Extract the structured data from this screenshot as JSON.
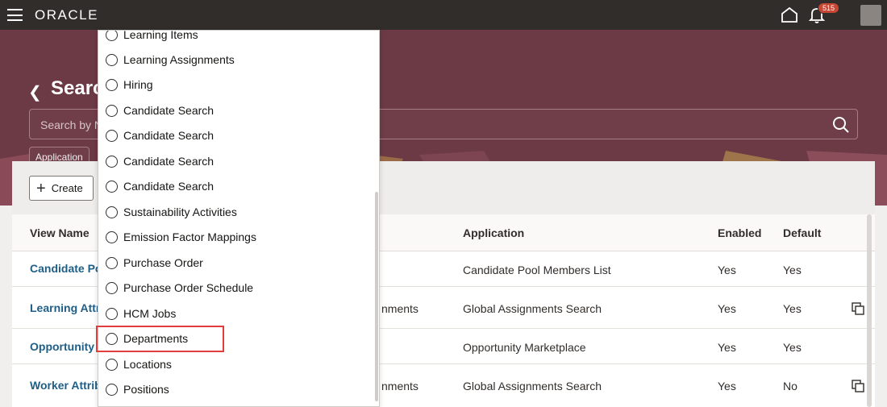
{
  "header": {
    "brand": "ORACLE",
    "notification_count": "515"
  },
  "hero": {
    "title": "Search",
    "search_placeholder": "Search by Name",
    "filter_chip": "Application"
  },
  "toolbar": {
    "create_label": "Create"
  },
  "table": {
    "columns": {
      "view_name": "View Name",
      "application": "Application",
      "enabled": "Enabled",
      "default": "Default"
    },
    "rows": [
      {
        "view_name": "Candidate Po",
        "middle": "",
        "application": "Candidate Pool Members List",
        "enabled": "Yes",
        "default": "Yes",
        "copy": false
      },
      {
        "view_name": "Learning Attri",
        "middle": "nments",
        "application": "Global Assignments Search",
        "enabled": "Yes",
        "default": "Yes",
        "copy": true
      },
      {
        "view_name": "Opportunity",
        "middle": "",
        "application": "Opportunity Marketplace",
        "enabled": "Yes",
        "default": "Yes",
        "copy": false
      },
      {
        "view_name": "Worker Attrib",
        "middle": "nments",
        "application": "Global Assignments Search",
        "enabled": "Yes",
        "default": "No",
        "copy": true
      }
    ]
  },
  "dropdown": {
    "items": [
      "Learning Items",
      "Learning Assignments",
      "Hiring",
      "Candidate Search",
      "Candidate Search",
      "Candidate Search",
      "Candidate Search",
      "Sustainability Activities",
      "Emission Factor Mappings",
      "Purchase Order",
      "Purchase Order Schedule",
      "HCM Jobs",
      "Departments",
      "Locations",
      "Positions"
    ],
    "highlighted_item": "Departments"
  },
  "colors": {
    "topbar": "#312d2a",
    "hero": "#6b3a45",
    "link": "#1f5e86",
    "highlight_border": "#e33c3c",
    "badge": "#c74634"
  }
}
